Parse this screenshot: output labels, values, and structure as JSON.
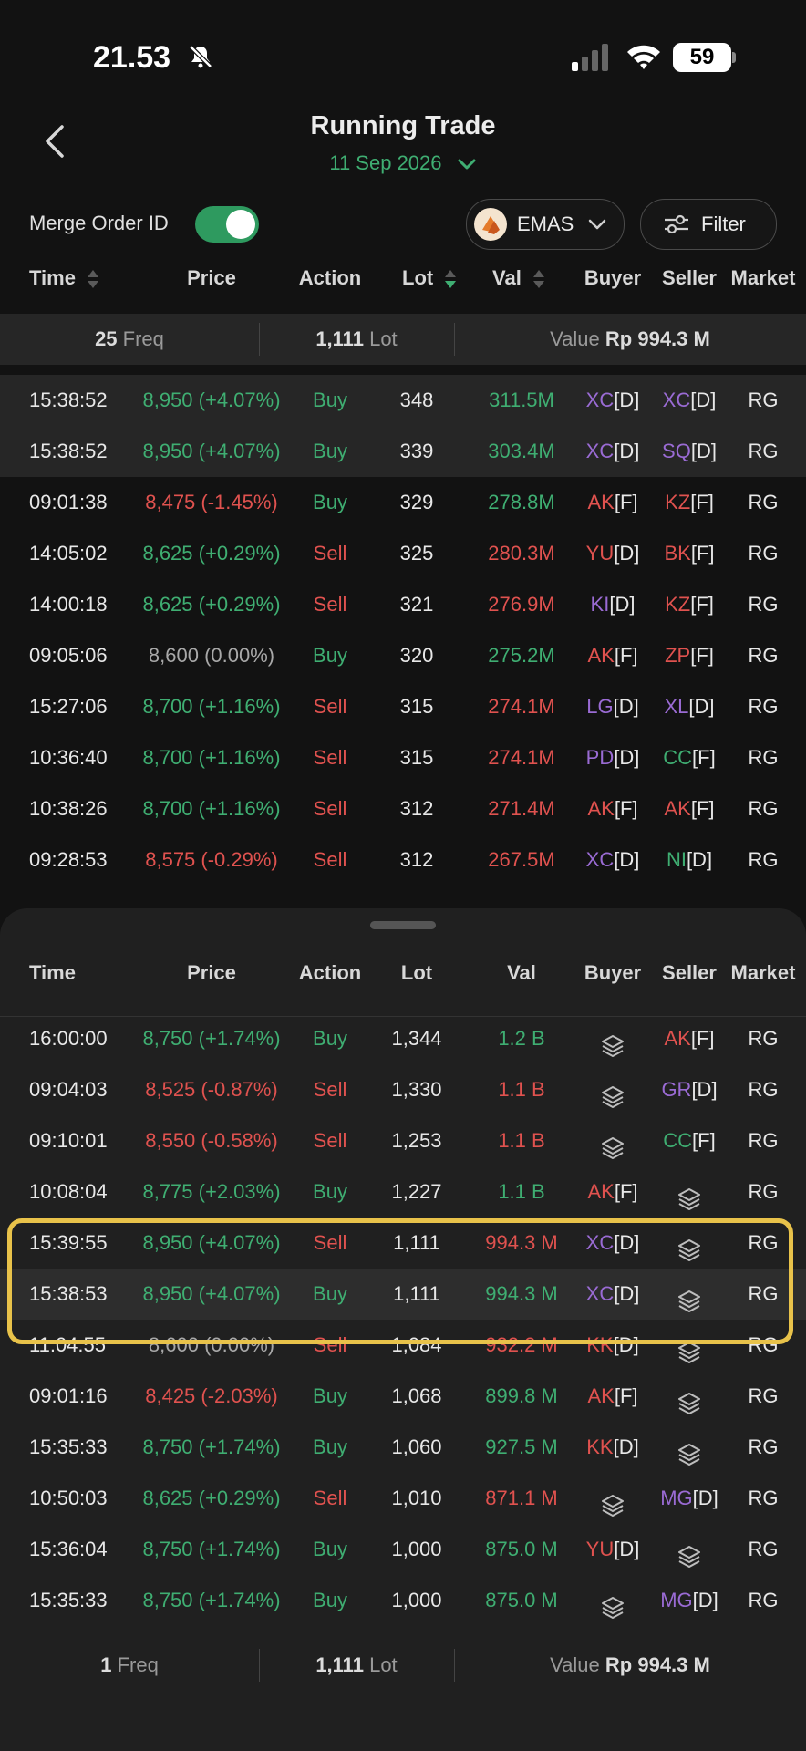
{
  "status": {
    "time": "21.53",
    "battery": "59"
  },
  "header": {
    "title": "Running Trade",
    "date": "11 Sep 2026"
  },
  "controls": {
    "merge_label": "Merge Order ID",
    "merge_on": true,
    "stock": "EMAS",
    "filter_label": "Filter"
  },
  "columns": {
    "time": "Time",
    "price": "Price",
    "action": "Action",
    "lot": "Lot",
    "val": "Val",
    "buyer": "Buyer",
    "seller": "Seller",
    "market": "Market"
  },
  "top_summary": {
    "freq_num": "25",
    "freq_label": "Freq",
    "lot_num": "1,111",
    "lot_label": "Lot",
    "value_label": "Value",
    "value": "Rp 994.3 M"
  },
  "top_rows": [
    {
      "time": "15:38:52",
      "price": "8,950 (+4.07%)",
      "pc": "green",
      "action": "Buy",
      "lot": "348",
      "val": "311.5M",
      "buyer": "XC",
      "bt": "[D]",
      "bc": "purple",
      "seller": "XC",
      "st": "[D]",
      "sc": "purple",
      "market": "RG"
    },
    {
      "time": "15:38:52",
      "price": "8,950 (+4.07%)",
      "pc": "green",
      "action": "Buy",
      "lot": "339",
      "val": "303.4M",
      "buyer": "XC",
      "bt": "[D]",
      "bc": "purple",
      "seller": "SQ",
      "st": "[D]",
      "sc": "purple",
      "market": "RG"
    },
    {
      "time": "09:01:38",
      "price": "8,475 (-1.45%)",
      "pc": "red",
      "action": "Buy",
      "lot": "329",
      "val": "278.8M",
      "buyer": "AK",
      "bt": "[F]",
      "bc": "red",
      "seller": "KZ",
      "st": "[F]",
      "sc": "red",
      "market": "RG"
    },
    {
      "time": "14:05:02",
      "price": "8,625 (+0.29%)",
      "pc": "green",
      "action": "Sell",
      "lot": "325",
      "val": "280.3M",
      "buyer": "YU",
      "bt": "[D]",
      "bc": "red",
      "seller": "BK",
      "st": "[F]",
      "sc": "red",
      "market": "RG"
    },
    {
      "time": "14:00:18",
      "price": "8,625 (+0.29%)",
      "pc": "green",
      "action": "Sell",
      "lot": "321",
      "val": "276.9M",
      "buyer": "KI",
      "bt": "[D]",
      "bc": "purple",
      "seller": "KZ",
      "st": "[F]",
      "sc": "red",
      "market": "RG"
    },
    {
      "time": "09:05:06",
      "price": "8,600 (0.00%)",
      "pc": "gray",
      "action": "Buy",
      "lot": "320",
      "val": "275.2M",
      "buyer": "AK",
      "bt": "[F]",
      "bc": "red",
      "seller": "ZP",
      "st": "[F]",
      "sc": "red",
      "market": "RG"
    },
    {
      "time": "15:27:06",
      "price": "8,700 (+1.16%)",
      "pc": "green",
      "action": "Sell",
      "lot": "315",
      "val": "274.1M",
      "buyer": "LG",
      "bt": "[D]",
      "bc": "purple",
      "seller": "XL",
      "st": "[D]",
      "sc": "purple",
      "market": "RG"
    },
    {
      "time": "10:36:40",
      "price": "8,700 (+1.16%)",
      "pc": "green",
      "action": "Sell",
      "lot": "315",
      "val": "274.1M",
      "buyer": "PD",
      "bt": "[D]",
      "bc": "purple",
      "seller": "CC",
      "st": "[F]",
      "sc": "green",
      "market": "RG"
    },
    {
      "time": "10:38:26",
      "price": "8,700 (+1.16%)",
      "pc": "green",
      "action": "Sell",
      "lot": "312",
      "val": "271.4M",
      "buyer": "AK",
      "bt": "[F]",
      "bc": "red",
      "seller": "AK",
      "st": "[F]",
      "sc": "red",
      "market": "RG"
    },
    {
      "time": "09:28:53",
      "price": "8,575 (-0.29%)",
      "pc": "red",
      "action": "Sell",
      "lot": "312",
      "val": "267.5M",
      "buyer": "XC",
      "bt": "[D]",
      "bc": "purple",
      "seller": "NI",
      "st": "[D]",
      "sc": "green",
      "market": "RG"
    }
  ],
  "sheet_rows": [
    {
      "time": "16:00:00",
      "price": "8,750 (+1.74%)",
      "pc": "green",
      "action": "Buy",
      "lot": "1,344",
      "val": "1.2 B",
      "buyer": "",
      "bt": "",
      "bc": "",
      "seller": "AK",
      "st": "[F]",
      "sc": "red",
      "market": "RG"
    },
    {
      "time": "09:04:03",
      "price": "8,525 (-0.87%)",
      "pc": "red",
      "action": "Sell",
      "lot": "1,330",
      "val": "1.1 B",
      "buyer": "",
      "bt": "",
      "bc": "",
      "seller": "GR",
      "st": "[D]",
      "sc": "purple",
      "market": "RG"
    },
    {
      "time": "09:10:01",
      "price": "8,550 (-0.58%)",
      "pc": "red",
      "action": "Sell",
      "lot": "1,253",
      "val": "1.1 B",
      "buyer": "",
      "bt": "",
      "bc": "",
      "seller": "CC",
      "st": "[F]",
      "sc": "green",
      "market": "RG"
    },
    {
      "time": "10:08:04",
      "price": "8,775 (+2.03%)",
      "pc": "green",
      "action": "Buy",
      "lot": "1,227",
      "val": "1.1 B",
      "buyer": "AK",
      "bt": "[F]",
      "bc": "red",
      "seller": "",
      "st": "",
      "sc": "",
      "market": "RG"
    },
    {
      "time": "15:39:55",
      "price": "8,950 (+4.07%)",
      "pc": "green",
      "action": "Sell",
      "lot": "1,111",
      "val": "994.3 M",
      "buyer": "XC",
      "bt": "[D]",
      "bc": "purple",
      "seller": "",
      "st": "",
      "sc": "",
      "market": "RG"
    },
    {
      "time": "15:38:53",
      "price": "8,950 (+4.07%)",
      "pc": "green",
      "action": "Buy",
      "lot": "1,111",
      "val": "994.3 M",
      "buyer": "XC",
      "bt": "[D]",
      "bc": "purple",
      "seller": "",
      "st": "",
      "sc": "",
      "market": "RG"
    },
    {
      "time": "11:04:55",
      "price": "8,600 (0.00%)",
      "pc": "gray",
      "action": "Sell",
      "lot": "1,084",
      "val": "932.2 M",
      "buyer": "KK",
      "bt": "[D]",
      "bc": "red",
      "seller": "",
      "st": "",
      "sc": "",
      "market": "RG"
    },
    {
      "time": "09:01:16",
      "price": "8,425 (-2.03%)",
      "pc": "red",
      "action": "Buy",
      "lot": "1,068",
      "val": "899.8 M",
      "buyer": "AK",
      "bt": "[F]",
      "bc": "red",
      "seller": "",
      "st": "",
      "sc": "",
      "market": "RG"
    },
    {
      "time": "15:35:33",
      "price": "8,750 (+1.74%)",
      "pc": "green",
      "action": "Buy",
      "lot": "1,060",
      "val": "927.5 M",
      "buyer": "KK",
      "bt": "[D]",
      "bc": "red",
      "seller": "",
      "st": "",
      "sc": "",
      "market": "RG"
    },
    {
      "time": "10:50:03",
      "price": "8,625 (+0.29%)",
      "pc": "green",
      "action": "Sell",
      "lot": "1,010",
      "val": "871.1 M",
      "buyer": "",
      "bt": "",
      "bc": "",
      "seller": "MG",
      "st": "[D]",
      "sc": "purple",
      "market": "RG"
    },
    {
      "time": "15:36:04",
      "price": "8,750 (+1.74%)",
      "pc": "green",
      "action": "Buy",
      "lot": "1,000",
      "val": "875.0 M",
      "buyer": "YU",
      "bt": "[D]",
      "bc": "red",
      "seller": "",
      "st": "",
      "sc": "",
      "market": "RG"
    },
    {
      "time": "15:35:33",
      "price": "8,750 (+1.74%)",
      "pc": "green",
      "action": "Buy",
      "lot": "1,000",
      "val": "875.0 M",
      "buyer": "",
      "bt": "",
      "bc": "",
      "seller": "MG",
      "st": "[D]",
      "sc": "purple",
      "market": "RG"
    }
  ],
  "sheet_summary": {
    "freq_num": "1",
    "freq_label": "Freq",
    "lot_num": "1,111",
    "lot_label": "Lot",
    "value_label": "Value",
    "value": "Rp 994.3 M"
  },
  "colors": {
    "green": "#3fae72",
    "red": "#e0524f",
    "purple": "#9a6bd4",
    "highlight": "#e8c24a",
    "background": "#121212",
    "sheet": "#202020"
  }
}
